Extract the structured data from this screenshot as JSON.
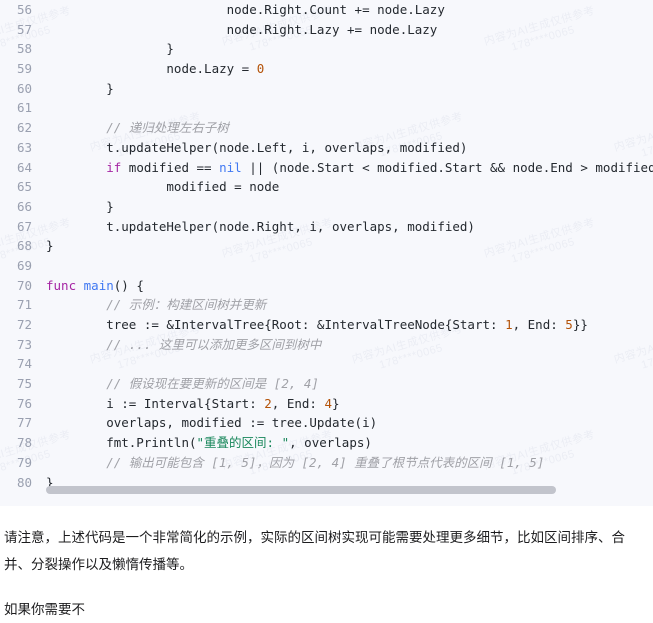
{
  "watermark": {
    "line1": "内容为AI生成仅供参考",
    "line2": "178****0065"
  },
  "code_block": {
    "language": "go",
    "first_line_number": 56,
    "colors": {
      "background": "#f7f8fc",
      "line_number": "#9aa0b0",
      "keyword": "#a626a4",
      "function": "#4078f2",
      "number": "#b45309",
      "string": "#19875b",
      "comment": "#a0a1a7",
      "plain": "#24292f",
      "scrollbar": "#c2c4cc"
    },
    "lines": [
      {
        "n": "56",
        "tokens": [
          {
            "t": "pl",
            "v": "                        node.Right.Count += node.Lazy"
          }
        ]
      },
      {
        "n": "57",
        "tokens": [
          {
            "t": "pl",
            "v": "                        node.Right.Lazy += node.Lazy"
          }
        ]
      },
      {
        "n": "58",
        "tokens": [
          {
            "t": "pl",
            "v": "                }"
          }
        ]
      },
      {
        "n": "59",
        "tokens": [
          {
            "t": "pl",
            "v": "                node.Lazy = "
          },
          {
            "t": "num",
            "v": "0"
          }
        ]
      },
      {
        "n": "60",
        "tokens": [
          {
            "t": "pl",
            "v": "        }"
          }
        ]
      },
      {
        "n": "61",
        "tokens": [
          {
            "t": "pl",
            "v": ""
          }
        ]
      },
      {
        "n": "62",
        "tokens": [
          {
            "t": "com",
            "v": "        // 递归处理左右子树"
          }
        ]
      },
      {
        "n": "63",
        "tokens": [
          {
            "t": "pl",
            "v": "        t.updateHelper(node.Left, i, overlaps, modified)"
          }
        ]
      },
      {
        "n": "64",
        "tokens": [
          {
            "t": "kw",
            "v": "        if"
          },
          {
            "t": "pl",
            "v": " modified == "
          },
          {
            "t": "bi",
            "v": "nil"
          },
          {
            "t": "pl",
            "v": " || (node.Start < modified.Start && node.End > modified.End"
          }
        ]
      },
      {
        "n": "65",
        "tokens": [
          {
            "t": "pl",
            "v": "                modified = node"
          }
        ]
      },
      {
        "n": "66",
        "tokens": [
          {
            "t": "pl",
            "v": "        }"
          }
        ]
      },
      {
        "n": "67",
        "tokens": [
          {
            "t": "pl",
            "v": "        t.updateHelper(node.Right, i, overlaps, modified)"
          }
        ]
      },
      {
        "n": "68",
        "tokens": [
          {
            "t": "pl",
            "v": "}"
          }
        ]
      },
      {
        "n": "69",
        "tokens": [
          {
            "t": "pl",
            "v": ""
          }
        ]
      },
      {
        "n": "70",
        "tokens": [
          {
            "t": "kw",
            "v": "func"
          },
          {
            "t": "pl",
            "v": " "
          },
          {
            "t": "fn",
            "v": "main"
          },
          {
            "t": "pl",
            "v": "() {"
          }
        ]
      },
      {
        "n": "71",
        "tokens": [
          {
            "t": "com",
            "v": "        // 示例：构建区间树并更新"
          }
        ]
      },
      {
        "n": "72",
        "tokens": [
          {
            "t": "pl",
            "v": "        tree := &IntervalTree{Root: &IntervalTreeNode{Start: "
          },
          {
            "t": "num",
            "v": "1"
          },
          {
            "t": "pl",
            "v": ", End: "
          },
          {
            "t": "num",
            "v": "5"
          },
          {
            "t": "pl",
            "v": "}}"
          }
        ]
      },
      {
        "n": "73",
        "tokens": [
          {
            "t": "com",
            "v": "        // ... 这里可以添加更多区间到树中"
          }
        ]
      },
      {
        "n": "74",
        "tokens": [
          {
            "t": "pl",
            "v": ""
          }
        ]
      },
      {
        "n": "75",
        "tokens": [
          {
            "t": "com",
            "v": "        // 假设现在要更新的区间是 [2, 4]"
          }
        ]
      },
      {
        "n": "76",
        "tokens": [
          {
            "t": "pl",
            "v": "        i := Interval{Start: "
          },
          {
            "t": "num",
            "v": "2"
          },
          {
            "t": "pl",
            "v": ", End: "
          },
          {
            "t": "num",
            "v": "4"
          },
          {
            "t": "pl",
            "v": "}"
          }
        ]
      },
      {
        "n": "77",
        "tokens": [
          {
            "t": "pl",
            "v": "        overlaps, modified := tree.Update(i)"
          }
        ]
      },
      {
        "n": "78",
        "tokens": [
          {
            "t": "pl",
            "v": "        fmt.Println("
          },
          {
            "t": "str",
            "v": "\"重叠的区间: \""
          },
          {
            "t": "pl",
            "v": ", overlaps)"
          }
        ]
      },
      {
        "n": "79",
        "tokens": [
          {
            "t": "com",
            "v": "        // 输出可能包含 [1, 5]，因为 [2, 4] 重叠了根节点代表的区间 [1, 5]"
          }
        ]
      },
      {
        "n": "80",
        "tokens": [
          {
            "t": "pl",
            "v": "}"
          }
        ]
      }
    ]
  },
  "prose": {
    "paragraph_1": "请注意，上述代码是一个非常简化的示例，实际的区间树实现可能需要处理更多细节，比如区间排序、合并、分裂操作以及懒惰传播等。",
    "paragraph_2": "如果你需要不"
  }
}
